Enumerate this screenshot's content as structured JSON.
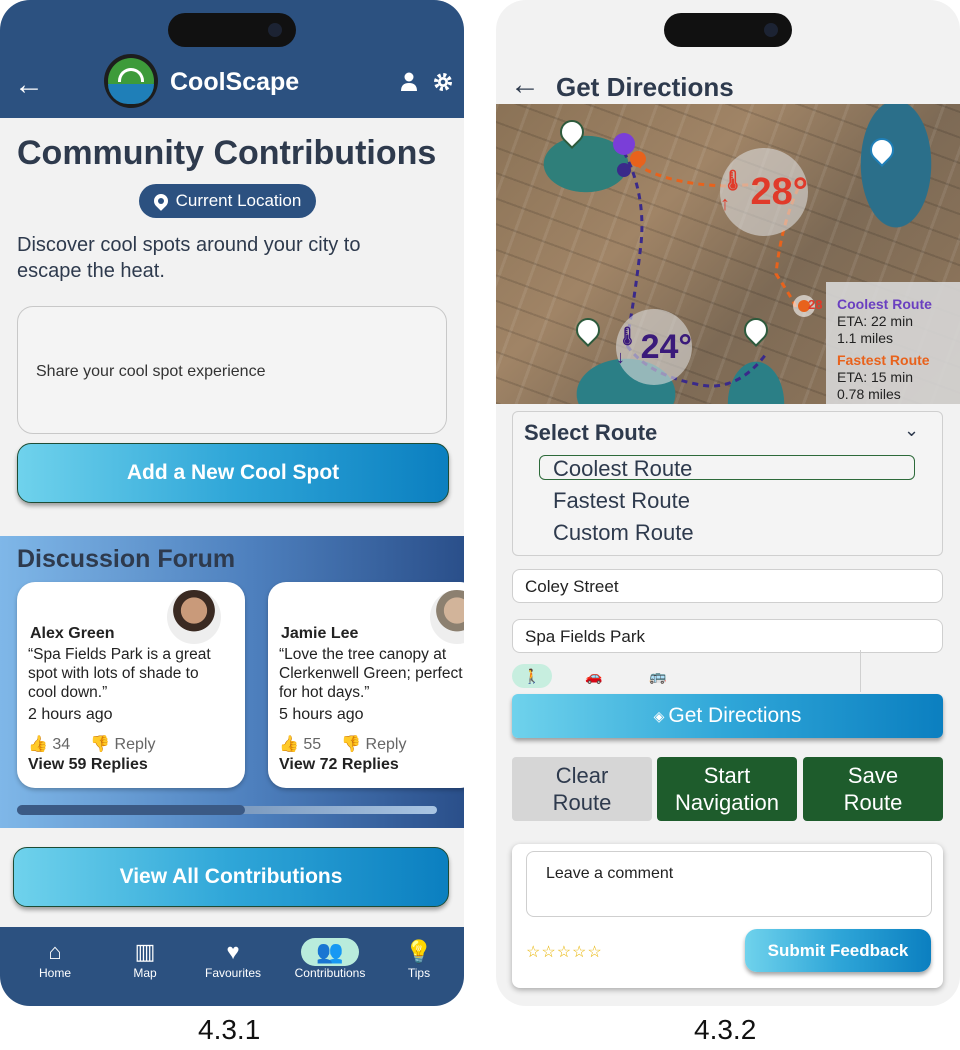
{
  "screen1": {
    "app_name": "CoolScape",
    "page_title": "Community Contributions",
    "location_label": "Current Location",
    "description": "Discover cool spots around your city to escape the heat.",
    "share_placeholder": "Share your cool spot experience",
    "add_button": "Add a New Cool Spot",
    "forum_title": "Discussion Forum",
    "posts": [
      {
        "name": "Alex Green",
        "quote": "“Spa Fields Park is a great spot with lots of shade to cool down.”",
        "time": "2 hours ago",
        "likes": "34",
        "reply": "Reply",
        "replies": "View 59 Replies"
      },
      {
        "name": "Jamie Lee",
        "quote": "“Love the tree canopy at Clerkenwell Green; perfect for hot days.”",
        "time": "5 hours ago",
        "likes": "55",
        "reply": "Reply",
        "replies": "View 72 Replies"
      }
    ],
    "view_all_button": "View All Contributions",
    "nav": [
      {
        "label": "Home",
        "icon": "home-icon"
      },
      {
        "label": "Map",
        "icon": "map-icon"
      },
      {
        "label": "Favourites",
        "icon": "heart-icon"
      },
      {
        "label": "Contributions",
        "icon": "people-icon"
      },
      {
        "label": "Tips",
        "icon": "lightbulb-icon"
      }
    ],
    "colors": {
      "header": "#2c5180",
      "active_nav": "#b9ecdc"
    }
  },
  "screen2": {
    "page_title": "Get Directions",
    "map": {
      "temp_hot": "28°",
      "temp_cool": "24°",
      "temp_small": "28",
      "coolest_route": "Coolest Route",
      "coolest_eta": "ETA: 22 min",
      "coolest_distance": "1.1 miles",
      "fastest_route": "Fastest Route",
      "fastest_eta": "ETA: 15 min",
      "fastest_distance": "0.78 miles"
    },
    "select_route_label": "Select Route",
    "route_options": [
      "Coolest Route",
      "Fastest Route",
      "Custom Route"
    ],
    "selected_route": "Coolest Route",
    "from_value": "Coley Street",
    "to_value": "Spa Fields Park",
    "modes": [
      "walk-icon",
      "car-icon",
      "bus-icon"
    ],
    "get_directions_button": "Get Directions",
    "clear_button": "Clear Route",
    "start_button": "Start Navigation",
    "save_button": "Save Route",
    "comment_placeholder": "Leave a comment",
    "stars": "☆☆☆☆☆",
    "submit_button": "Submit Feedback",
    "colors": {
      "dark_green": "#1e5c2c",
      "clear_gray": "#d6d6d6",
      "coolest": "#6a3fc0",
      "fastest": "#e8621c"
    }
  },
  "captions": [
    "4.3.1",
    "4.3.2"
  ]
}
